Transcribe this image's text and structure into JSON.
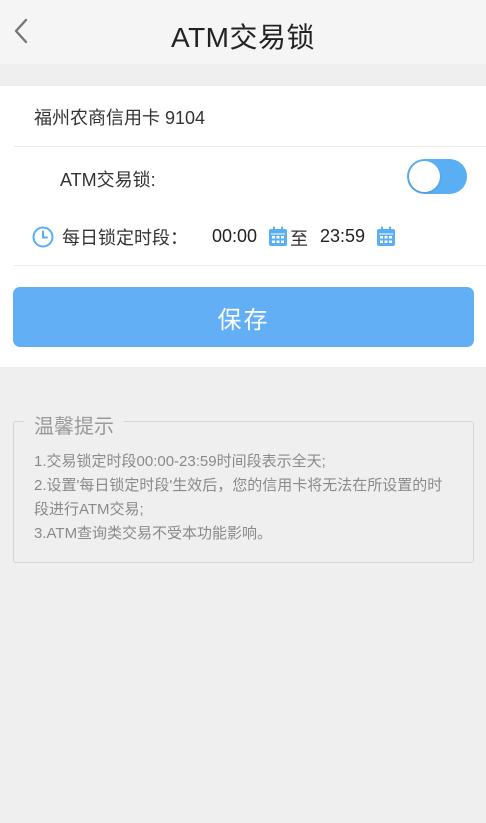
{
  "header": {
    "title": "ATM交易锁",
    "back_icon": "chevron-left-icon"
  },
  "card": {
    "account": "福州农商信用卡 9104",
    "lock_label": "ATM交易锁:",
    "toggle_on": true,
    "period_label": "每日锁定时段：",
    "start_time": "00:00",
    "to_label": "至",
    "end_time": "23:59"
  },
  "actions": {
    "save_label": "保存"
  },
  "tips": {
    "title": "温馨提示",
    "lines": [
      "1.交易锁定时段00:00-23:59时间段表示全天;",
      "2.设置'每日锁定时段'生效后，您的信用卡将无法在所设置的时段进行ATM交易;",
      "3.ATM查询类交易不受本功能影响。"
    ]
  },
  "colors": {
    "accent": "#5aaef3",
    "button": "#62aff6",
    "background": "#efefef"
  }
}
